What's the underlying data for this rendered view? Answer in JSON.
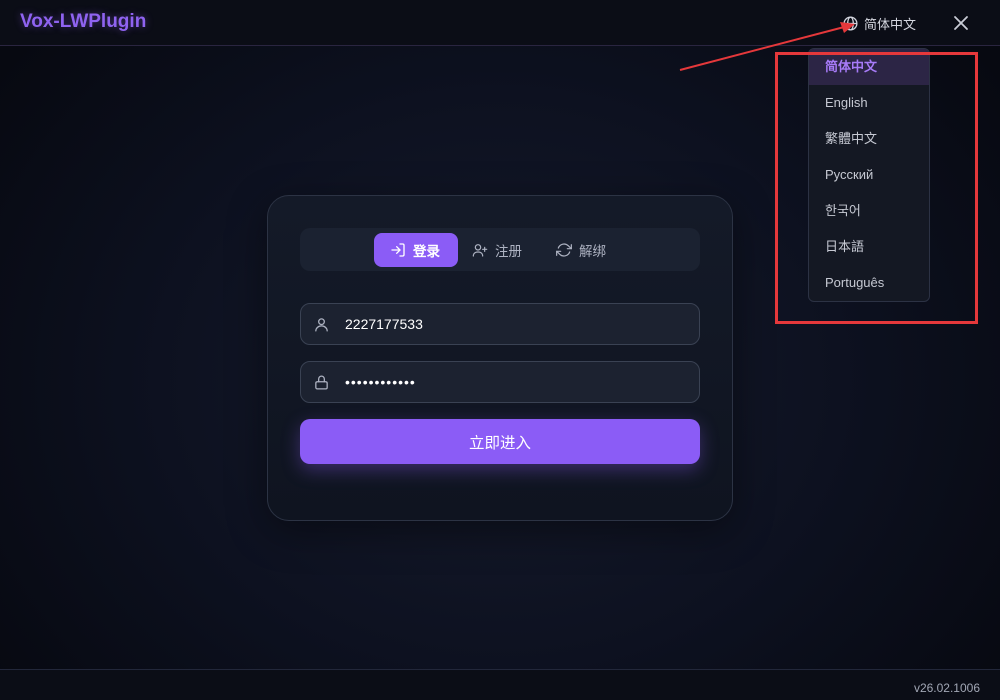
{
  "app": {
    "title": "Vox-LWPlugin",
    "version": "v26.02.1006"
  },
  "header": {
    "language_label": "简体中文"
  },
  "tabs": [
    {
      "label": "登录",
      "icon": "login-icon",
      "active": true
    },
    {
      "label": "注册",
      "icon": "user-plus-icon",
      "active": false
    },
    {
      "label": "解绑",
      "icon": "refresh-icon",
      "active": false
    }
  ],
  "form": {
    "username_value": "2227177533",
    "password_value": "••••••••••••",
    "submit_label": "立即进入"
  },
  "language_menu": {
    "items": [
      {
        "label": "简体中文",
        "selected": true
      },
      {
        "label": "English",
        "selected": false
      },
      {
        "label": "繁體中文",
        "selected": false
      },
      {
        "label": "Русский",
        "selected": false
      },
      {
        "label": "한국어",
        "selected": false
      },
      {
        "label": "日本語",
        "selected": false
      },
      {
        "label": "Português",
        "selected": false
      }
    ]
  },
  "colors": {
    "accent": "#8b5cf6",
    "title": "#8f63f0",
    "annotation": "#e5383b"
  }
}
